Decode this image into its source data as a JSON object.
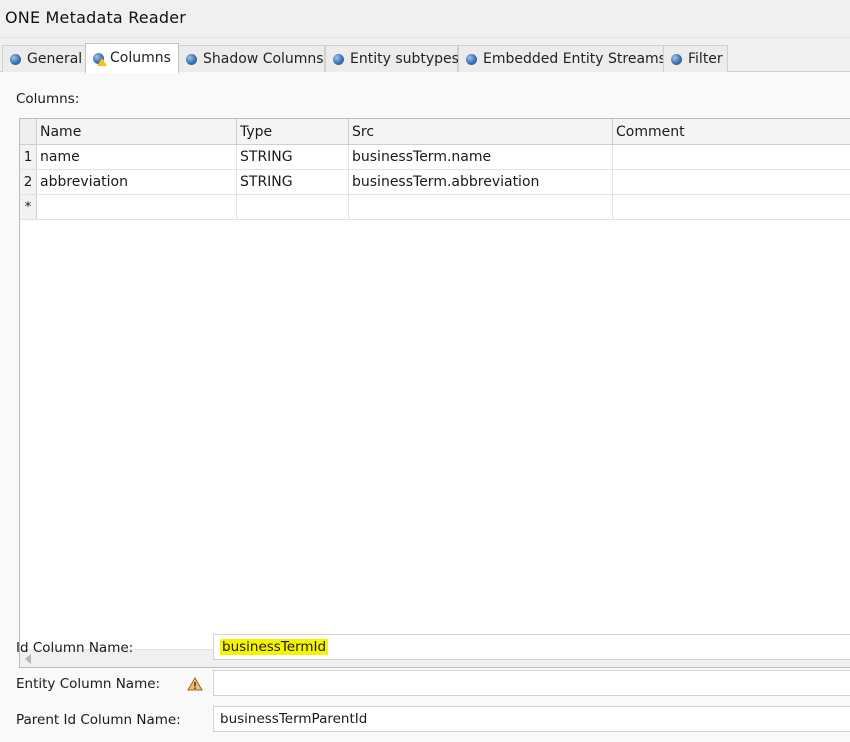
{
  "window": {
    "title": "ONE Metadata Reader"
  },
  "tabs": [
    {
      "label": "General",
      "icon": "blue-ball-icon",
      "active": false
    },
    {
      "label": "Columns",
      "icon": "blue-ball-warning-icon",
      "active": true
    },
    {
      "label": "Shadow Columns",
      "icon": "blue-ball-icon",
      "active": false
    },
    {
      "label": "Entity subtypes",
      "icon": "blue-ball-icon",
      "active": false
    },
    {
      "label": "Embedded Entity Streams",
      "icon": "blue-ball-icon",
      "active": false
    },
    {
      "label": "Filter",
      "icon": "blue-ball-icon",
      "active": false
    }
  ],
  "columns_section": {
    "label": "Columns:",
    "headers": [
      "Name",
      "Type",
      "Src",
      "Comment"
    ],
    "rows": [
      {
        "num": "1",
        "name": "name",
        "type": "STRING",
        "src": "businessTerm.name",
        "comment": ""
      },
      {
        "num": "2",
        "name": "abbreviation",
        "type": "STRING",
        "src": "businessTerm.abbreviation",
        "comment": ""
      }
    ],
    "new_row_marker": "*"
  },
  "form": {
    "id_column": {
      "label": "Id Column Name:",
      "value": "businessTermId",
      "highlighted": true
    },
    "entity_column": {
      "label": "Entity Column Name:",
      "value": "",
      "warning_icon": "warning-icon"
    },
    "parent_id_column": {
      "label": "Parent Id Column Name:",
      "value": "businessTermParentId"
    }
  },
  "colors": {
    "highlight": "#f5f500",
    "tab_icon": "#3c6fb1",
    "warning": "#f3c219"
  }
}
